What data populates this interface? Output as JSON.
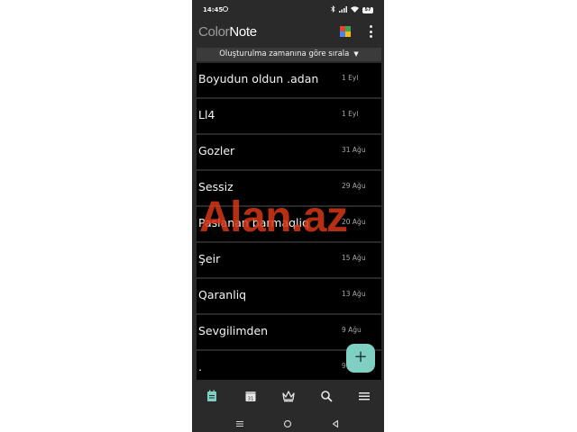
{
  "status_bar": {
    "time": "14:45",
    "battery": "57",
    "icons": [
      "whatsapp-icon",
      "bluetooth-icon",
      "signal-icon",
      "wifi-icon",
      "battery-icon"
    ]
  },
  "header": {
    "title_part1": "Color",
    "title_part2": "Note"
  },
  "sort_bar": {
    "label": "Oluşturulma zamanına göre sırala"
  },
  "notes": [
    {
      "title": "Boyudun oldun .adan",
      "date": "1 Eyl"
    },
    {
      "title": "Ll4",
      "date": "1 Eyl"
    },
    {
      "title": "Gozler",
      "date": "31 Ağu"
    },
    {
      "title": "Sessiz",
      "date": "29 Ağu"
    },
    {
      "title": "Paslanan barmaqliq",
      "date": "20 Ağu"
    },
    {
      "title": "Şeir",
      "date": "15 Ağu"
    },
    {
      "title": "Qaranliq",
      "date": "13 Ağu"
    },
    {
      "title": "Sevgilimden",
      "date": "9 Ağu"
    },
    {
      "title": ".",
      "date": "9"
    }
  ],
  "fab": {
    "label": "+"
  },
  "watermark": {
    "text": "Alan.az"
  },
  "bottom_nav": [
    "notes-icon",
    "calendar-icon",
    "crown-icon",
    "search-icon",
    "menu-icon"
  ],
  "colors": {
    "accent": "#7fcfc3",
    "background": "#2a2a2a",
    "note_background": "#000000",
    "watermark": "#d63719"
  }
}
